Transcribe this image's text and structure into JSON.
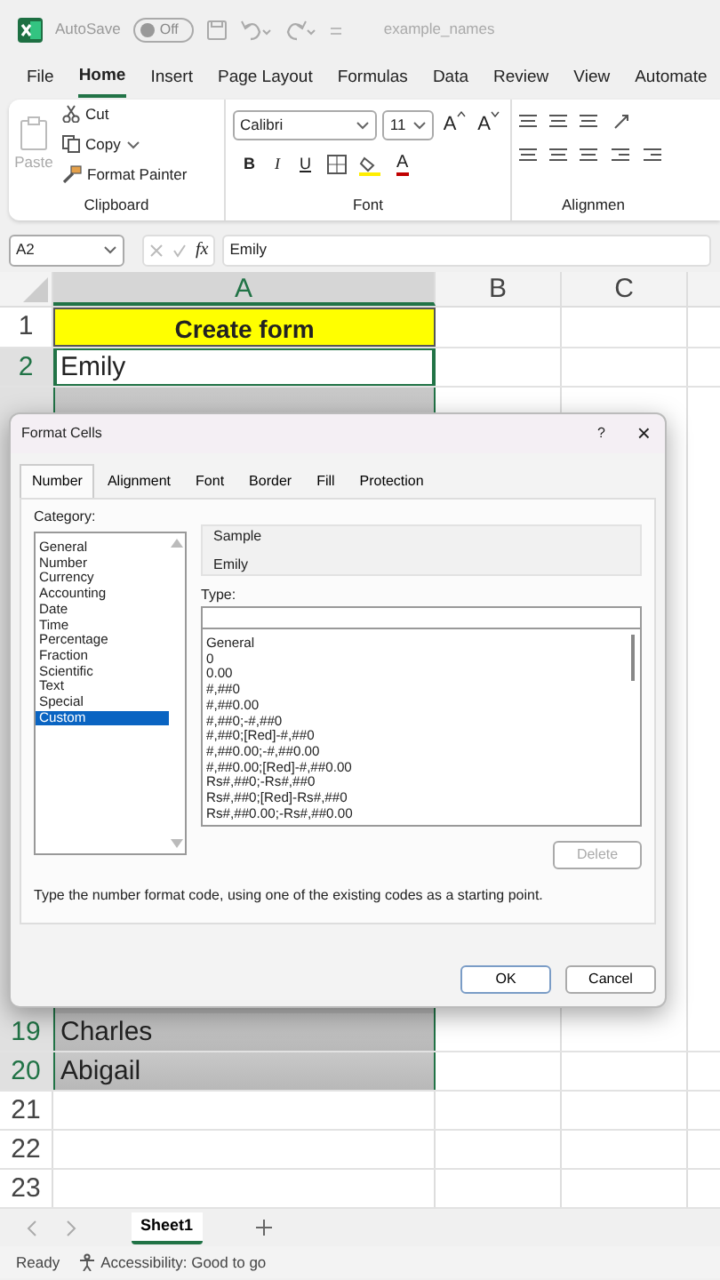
{
  "title_bar": {
    "autosave_label": "AutoSave",
    "autosave": {
      "label": "Off",
      "on": false
    },
    "file_name": "example_names"
  },
  "ribbon_tabs": [
    {
      "label": "File",
      "selected": false
    },
    {
      "label": "Home",
      "selected": true
    },
    {
      "label": "Insert",
      "selected": false
    },
    {
      "label": "Page Layout",
      "selected": false
    },
    {
      "label": "Formulas",
      "selected": false
    },
    {
      "label": "Data",
      "selected": false
    },
    {
      "label": "Review",
      "selected": false
    },
    {
      "label": "View",
      "selected": false
    },
    {
      "label": "Automate",
      "selected": false
    }
  ],
  "ribbon": {
    "clipboard": {
      "paste": {
        "label": "Paste",
        "disabled": true
      },
      "cut": "Cut",
      "copy": "Copy",
      "format_painter": "Format Painter",
      "group_label": "Clipboard"
    },
    "font": {
      "font_name": "Calibri",
      "font_size": "11",
      "grow": "A",
      "shrink": "A",
      "bold": "B",
      "italic": "I",
      "underline": "U",
      "font_color": "A",
      "group_label": "Font"
    },
    "alignment": {
      "group_label": "Alignmen"
    }
  },
  "formula_bar": {
    "name_box": "A2",
    "function_label": "fx",
    "value": "Emily"
  },
  "columns": [
    "A",
    "B",
    "C"
  ],
  "rows": [
    {
      "number": "1",
      "a": "Create form",
      "kind": "title",
      "selected": false,
      "active": false
    },
    {
      "number": "2",
      "a": "Emily",
      "kind": "name",
      "selected": true,
      "active": true
    },
    {
      "number": "19",
      "a": "Charles",
      "kind": "name",
      "selected": true,
      "active": false
    },
    {
      "number": "20",
      "a": "Abigail",
      "kind": "name",
      "selected": true,
      "active": false
    },
    {
      "number": "21",
      "a": "",
      "kind": "empty",
      "selected": false,
      "active": false
    },
    {
      "number": "22",
      "a": "",
      "kind": "empty",
      "selected": false,
      "active": false
    },
    {
      "number": "23",
      "a": "",
      "kind": "empty",
      "selected": false,
      "active": false
    }
  ],
  "dialog": {
    "title": "Format Cells",
    "help": "?",
    "close": "×",
    "tabs": [
      {
        "label": "Number",
        "selected": true
      },
      {
        "label": "Alignment",
        "selected": false
      },
      {
        "label": "Font",
        "selected": false
      },
      {
        "label": "Border",
        "selected": false
      },
      {
        "label": "Fill",
        "selected": false
      },
      {
        "label": "Protection",
        "selected": false
      }
    ],
    "category_label": "Category:",
    "categories": [
      {
        "label": "General",
        "selected": false
      },
      {
        "label": "Number",
        "selected": false
      },
      {
        "label": "Currency",
        "selected": false
      },
      {
        "label": "Accounting",
        "selected": false
      },
      {
        "label": "Date",
        "selected": false
      },
      {
        "label": "Time",
        "selected": false
      },
      {
        "label": "Percentage",
        "selected": false
      },
      {
        "label": "Fraction",
        "selected": false
      },
      {
        "label": "Scientific",
        "selected": false
      },
      {
        "label": "Text",
        "selected": false
      },
      {
        "label": "Special",
        "selected": false
      },
      {
        "label": "Custom",
        "selected": true
      }
    ],
    "sample_label": "Sample",
    "sample_value": "Emily",
    "type_label": "Type:",
    "type_codes": [
      "General",
      "0",
      "0.00",
      "#,##0",
      "#,##0.00",
      "#,##0;-#,##0",
      "#,##0;[Red]-#,##0",
      "#,##0.00;-#,##0.00",
      "#,##0.00;[Red]-#,##0.00",
      "Rs#,##0;-Rs#,##0",
      "Rs#,##0;[Red]-Rs#,##0",
      "Rs#,##0.00;-Rs#,##0.00"
    ],
    "delete": {
      "label": "Delete",
      "disabled": true
    },
    "description": "Type the number format code, using one of the existing codes as a starting point.",
    "ok": "OK",
    "cancel": "Cancel"
  },
  "sheet_tabs": [
    {
      "label": "Sheet1",
      "selected": true
    }
  ],
  "status_bar": {
    "ready": "Ready",
    "accessibility": "Accessibility: Good to go"
  }
}
